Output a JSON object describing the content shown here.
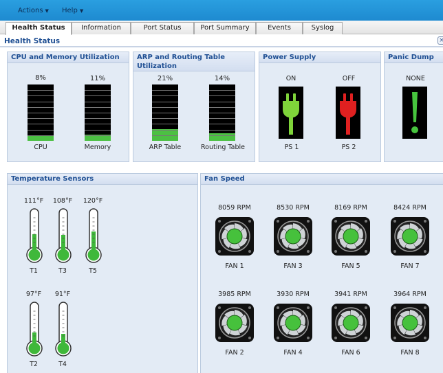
{
  "menu": [
    {
      "label": "Actions"
    },
    {
      "label": "Help"
    }
  ],
  "tabs": [
    {
      "label": "Health Status",
      "active": true
    },
    {
      "label": "Information"
    },
    {
      "label": "Port Status"
    },
    {
      "label": "Port Summary"
    },
    {
      "label": "Events"
    },
    {
      "label": "Syslog"
    }
  ],
  "page_title": "Health Status",
  "close_label": "×",
  "cpu_mem": {
    "title": "CPU and Memory Utilization",
    "gauges": [
      {
        "pct": "8%",
        "fraction": 0.08,
        "label": "CPU"
      },
      {
        "pct": "11%",
        "fraction": 0.11,
        "label": "Memory"
      }
    ]
  },
  "arp": {
    "title_line1": "ARP and Routing Table",
    "title_line2": "Utilization",
    "gauges": [
      {
        "pct": "21%",
        "fraction": 0.21,
        "label": "ARP Table"
      },
      {
        "pct": "14%",
        "fraction": 0.14,
        "label": "Routing Table"
      }
    ]
  },
  "power": {
    "title": "Power Supply",
    "supplies": [
      {
        "state": "ON",
        "label": "PS 1",
        "color": "#7fd43a"
      },
      {
        "state": "OFF",
        "label": "PS 2",
        "color": "#e02020"
      }
    ]
  },
  "panic": {
    "title": "Panic Dump",
    "state": "NONE",
    "color": "#47c43e"
  },
  "temps": {
    "title": "Temperature Sensors",
    "sensors": [
      {
        "value": "111°F",
        "label": "T1",
        "fraction": 0.42
      },
      {
        "value": "108°F",
        "label": "T3",
        "fraction": 0.4
      },
      {
        "value": "120°F",
        "label": "T5",
        "fraction": 0.48
      },
      {
        "value": "97°F",
        "label": "T2",
        "fraction": 0.3
      },
      {
        "value": "91°F",
        "label": "T4",
        "fraction": 0.26
      }
    ]
  },
  "fans": {
    "title": "Fan Speed",
    "units": [
      {
        "rpm": "8059 RPM",
        "label": "FAN 1"
      },
      {
        "rpm": "8530 RPM",
        "label": "FAN 3"
      },
      {
        "rpm": "8169 RPM",
        "label": "FAN 5"
      },
      {
        "rpm": "8424 RPM",
        "label": "FAN 7"
      },
      {
        "rpm": "3985 RPM",
        "label": "FAN 2"
      },
      {
        "rpm": "3930 RPM",
        "label": "FAN 4"
      },
      {
        "rpm": "3941 RPM",
        "label": "FAN 6"
      },
      {
        "rpm": "3964 RPM",
        "label": "FAN 8"
      }
    ]
  },
  "colors": {
    "accent": "#1e8ad0",
    "heading": "#1f4f93",
    "good": "#4cc043"
  }
}
